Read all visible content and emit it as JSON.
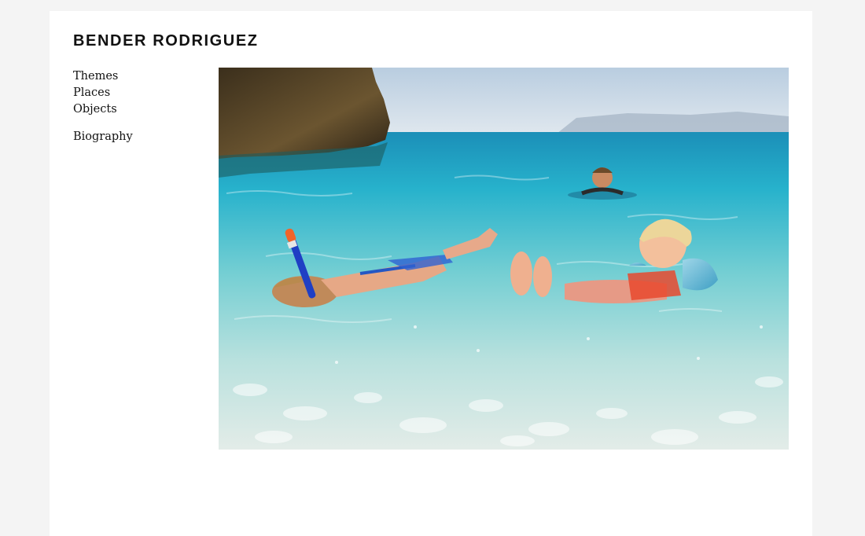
{
  "site": {
    "title": "BENDER RODRIGUEZ"
  },
  "nav": {
    "primary": [
      {
        "label": "Themes"
      },
      {
        "label": "Places"
      },
      {
        "label": "Objects"
      }
    ],
    "secondary": [
      {
        "label": "Biography"
      }
    ]
  },
  "photo": {
    "subject": "children-swimming-in-sea",
    "colors": {
      "sky": "#c9d8e6",
      "sea_deep": "#1fa7c9",
      "sea_shallow": "#7fd0d8",
      "rock": "#4a3a22",
      "seabed": "#d8e4e2"
    }
  }
}
